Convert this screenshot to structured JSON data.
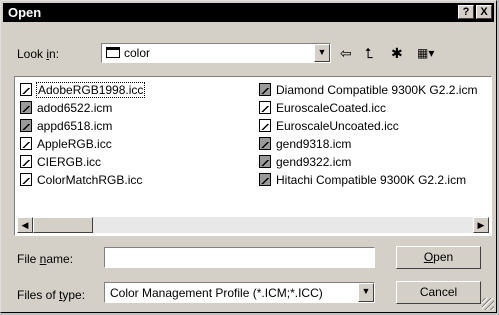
{
  "window": {
    "title": "Open",
    "help_label": "?",
    "close_label": "X"
  },
  "lookin": {
    "label_prefix": "Look ",
    "label_hot": "i",
    "label_suffix": "n:",
    "value": "color"
  },
  "toolbar": {
    "back_icon": "⇦",
    "up_icon": "⮤",
    "newfolder_icon": "✱",
    "view_icon": "▦▾"
  },
  "files": {
    "left": [
      {
        "name": "AdobeRGB1998.icc",
        "icon": "profile-icon",
        "selected": true
      },
      {
        "name": "adod6522.icm",
        "icon": "profile-icon-dark"
      },
      {
        "name": "appd6518.icm",
        "icon": "profile-icon-dark"
      },
      {
        "name": "AppleRGB.icc",
        "icon": "profile-icon"
      },
      {
        "name": "CIERGB.icc",
        "icon": "profile-icon"
      },
      {
        "name": "ColorMatchRGB.icc",
        "icon": "profile-icon"
      }
    ],
    "right": [
      {
        "name": "Diamond Compatible 9300K G2.2.icm",
        "icon": "profile-icon-dark"
      },
      {
        "name": "EuroscaleCoated.icc",
        "icon": "profile-icon"
      },
      {
        "name": "EuroscaleUncoated.icc",
        "icon": "profile-icon"
      },
      {
        "name": "gend9318.icm",
        "icon": "profile-icon-dark"
      },
      {
        "name": "gend9322.icm",
        "icon": "profile-icon-dark"
      },
      {
        "name": "Hitachi Compatible 9300K G2.2.icm",
        "icon": "profile-icon-dark"
      }
    ]
  },
  "filename": {
    "label_prefix": "File ",
    "label_hot": "n",
    "label_suffix": "ame:",
    "value": ""
  },
  "filetype": {
    "label_prefix": "Files of ",
    "label_hot": "t",
    "label_suffix": "ype:",
    "value": "Color Management Profile (*.ICM;*.ICC)"
  },
  "buttons": {
    "open_hot": "O",
    "open_rest": "pen",
    "cancel": "Cancel"
  }
}
